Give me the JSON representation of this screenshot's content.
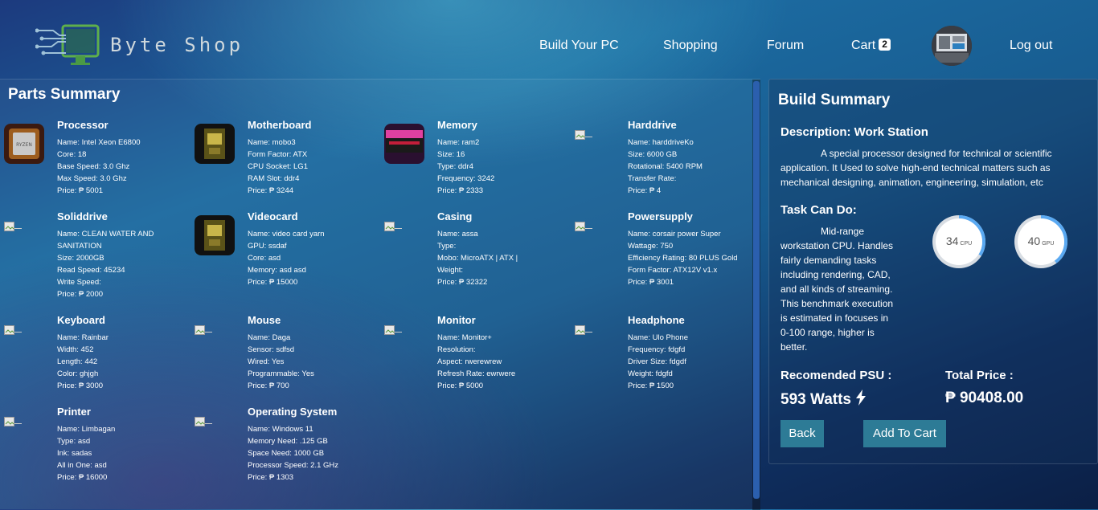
{
  "brand": {
    "name": "Byte Shop"
  },
  "nav": {
    "build_pc": "Build Your PC",
    "shopping": "Shopping",
    "forum": "Forum",
    "cart": "Cart",
    "cart_count": "2",
    "logout": "Log out"
  },
  "parts": {
    "title": "Parts Summary",
    "items": [
      {
        "name": "Processor",
        "specs": [
          "Name: Intel Xeon E6800",
          "Core: 18",
          "Base Speed: 3.0 Ghz",
          "Max Speed: 3.0 Ghz",
          "Price: ₱ 5001"
        ]
      },
      {
        "name": "Motherboard",
        "specs": [
          "Name: mobo3",
          "Form Factor: ATX",
          "CPU Socket: LG1",
          "RAM Slot: ddr4",
          "Price: ₱ 3244"
        ]
      },
      {
        "name": "Memory",
        "specs": [
          "Name: ram2",
          "Size: 16",
          "Type: ddr4",
          "Frequency: 3242",
          "Price: ₱ 2333"
        ]
      },
      {
        "name": "Harddrive",
        "specs": [
          "Name: harddriveKo",
          "Size: 6000 GB",
          "Rotational: 5400 RPM",
          "Transfer Rate:",
          "Price: ₱ 4"
        ]
      },
      {
        "name": "Soliddrive",
        "specs": [
          "Name: CLEAN WATER AND SANITATION",
          "Size: 2000GB",
          "Read Speed: 45234",
          "Write Speed:",
          "Price: ₱ 2000"
        ]
      },
      {
        "name": "Videocard",
        "specs": [
          "Name: video card yarn",
          "GPU: ssdaf",
          "Core: asd",
          "Memory: asd asd",
          "Price: ₱ 15000"
        ]
      },
      {
        "name": "Casing",
        "specs": [
          "Name: assa",
          "Type:",
          "Mobo: MicroATX | ATX |",
          "Weight:",
          "Price: ₱ 32322"
        ]
      },
      {
        "name": "Powersupply",
        "specs": [
          "Name: corsair power Super",
          "Wattage: 750",
          "Efficiency Rating: 80 PLUS Gold",
          "Form Factor: ATX12V v1.x",
          "Price: ₱ 3001"
        ]
      },
      {
        "name": "Keyboard",
        "specs": [
          "Name: Rainbar",
          "Width: 452",
          "Length: 442",
          "Color: ghjgh",
          "Price: ₱ 3000"
        ]
      },
      {
        "name": "Mouse",
        "specs": [
          "Name: Daga",
          "Sensor: sdfsd",
          "Wired: Yes",
          "Programmable: Yes",
          "Price: ₱ 700"
        ]
      },
      {
        "name": "Monitor",
        "specs": [
          "Name: Monitor+",
          "Resolution:",
          "Aspect: rwerewrew",
          "Refresh Rate: ewrwere",
          "Price: ₱ 5000"
        ]
      },
      {
        "name": "Headphone",
        "specs": [
          "Name: Ulo Phone",
          "Frequency: fdgfd",
          "Driver Size: fdgdf",
          "Weight: fdgfd",
          "Price: ₱ 1500"
        ]
      },
      {
        "name": "Printer",
        "specs": [
          "Name: Limbagan",
          "Type: asd",
          "Ink: sadas",
          "All in One: asd",
          "Price: ₱ 16000"
        ]
      },
      {
        "name": "Operating System",
        "specs": [
          "Name: Windows 11",
          "Memory Need: .125 GB",
          "Space Need: 1000 GB",
          "Processor Speed: 2.1 GHz",
          "Price: ₱ 1303"
        ]
      }
    ]
  },
  "build": {
    "title": "Build Summary",
    "description_heading": "Description: Work Station",
    "description": "A special processor designed for technical or scientific application. It Used to solve high-end technical matters such as mechanical designing, animation, engineering, simulation, etc",
    "task_heading": "Task Can Do:",
    "task_text": "Mid-range workstation CPU. Handles fairly demanding tasks including rendering, CAD, and all kinds of streaming. This benchmark execution is estimated in focuses in 0-100 range, higher is better.",
    "cpu_score": "34",
    "cpu_unit": "CPU",
    "gpu_score": "40",
    "gpu_unit": "GPU",
    "psu_label": "Recomended PSU :",
    "psu_value": "593 Watts",
    "total_label": "Total Price :",
    "total_value": "₱ 90408.00",
    "back_label": "Back",
    "add_cart_label": "Add To Cart",
    "gauge_color": "#5aa9f2"
  }
}
